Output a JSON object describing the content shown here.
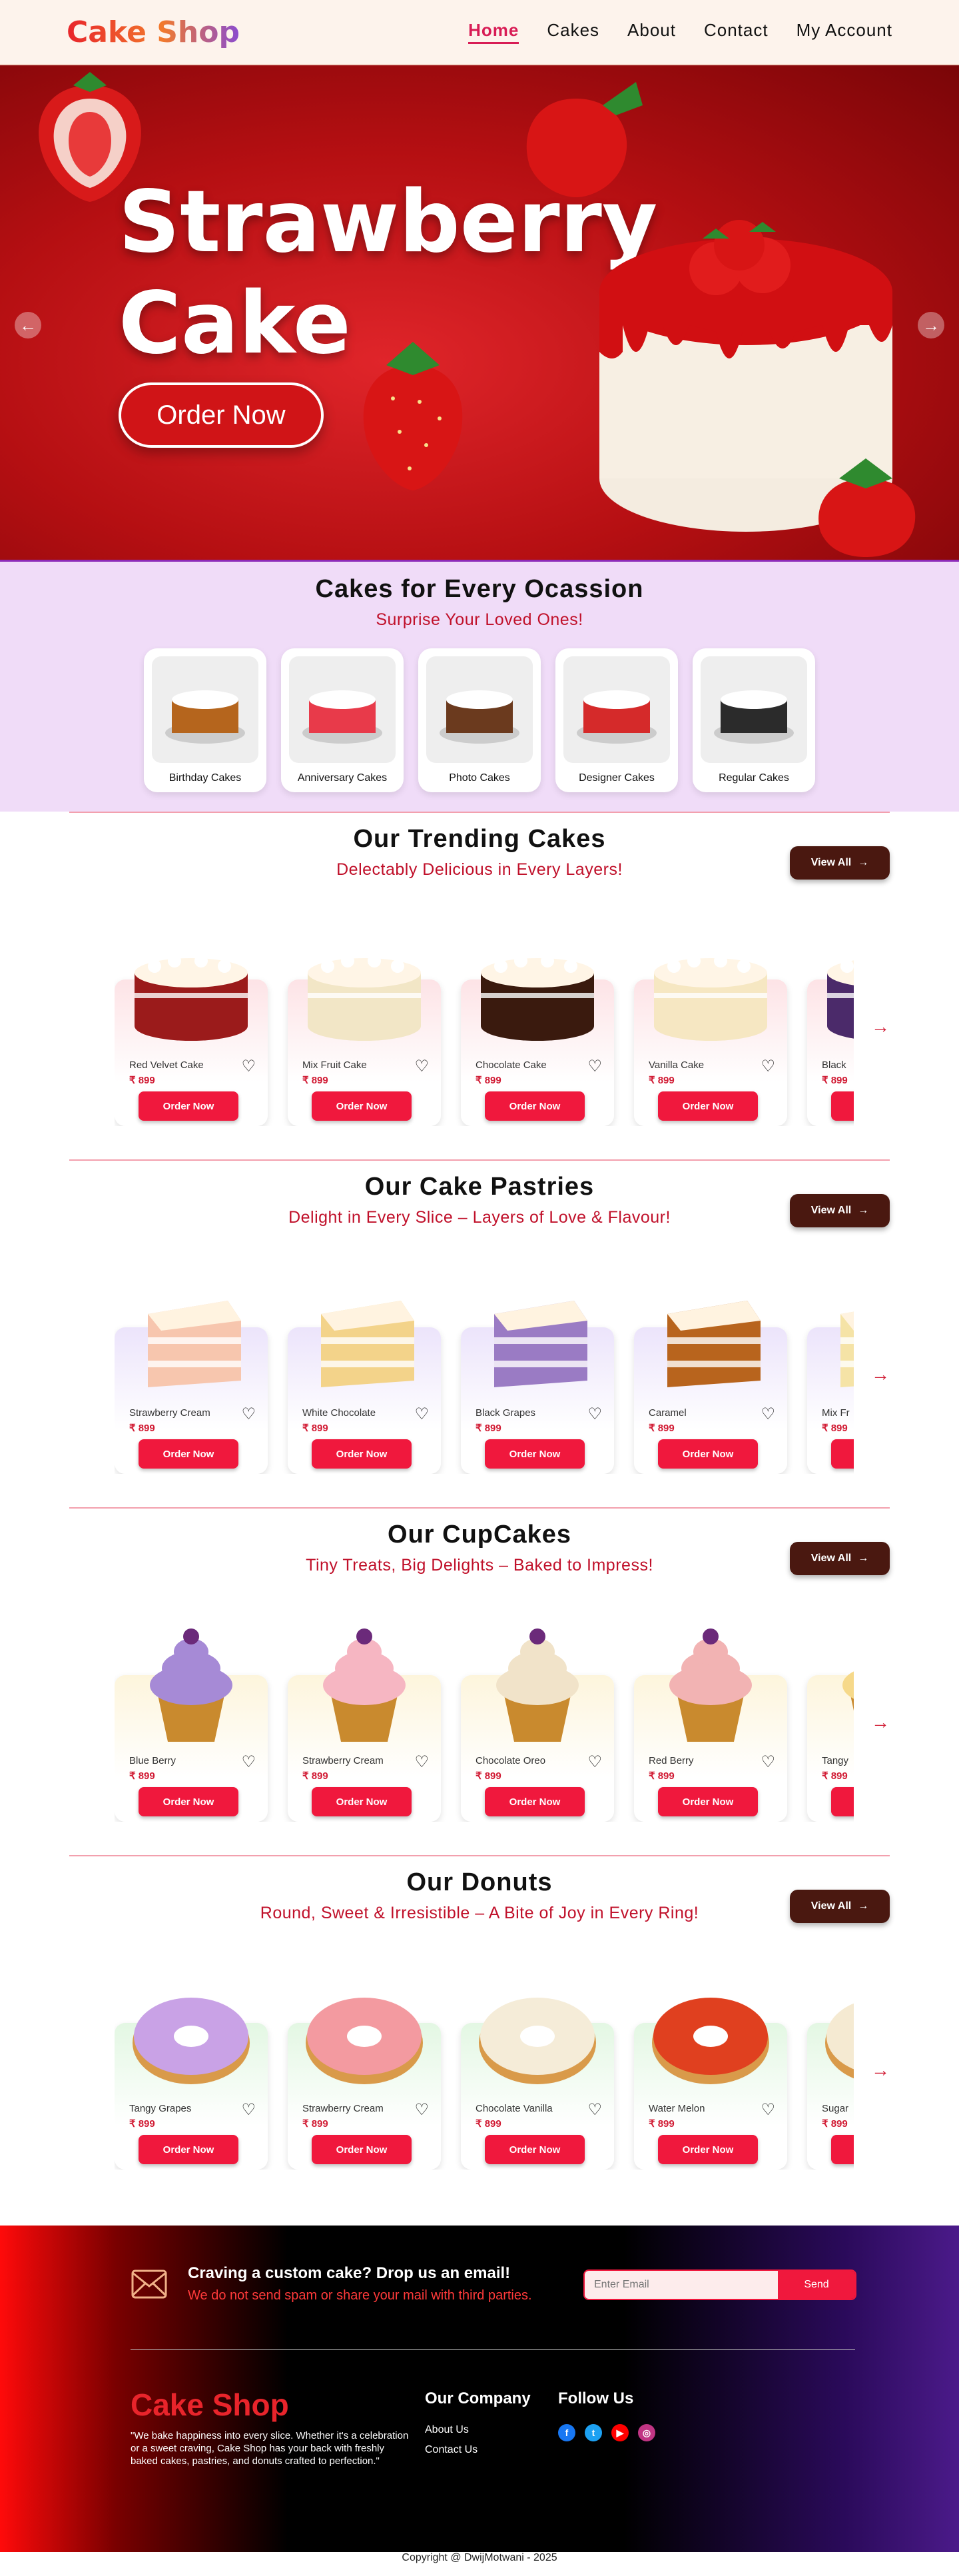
{
  "brand": "Cake Shop",
  "nav": [
    "Home",
    "Cakes",
    "About",
    "Contact",
    "My Account"
  ],
  "hero": {
    "title_line1": "Strawberry",
    "title_line2": "Cake",
    "cta": "Order Now"
  },
  "occasions": {
    "title": "Cakes for Every Ocassion",
    "subtitle": "Surprise Your Loved Ones!",
    "items": [
      {
        "label": "Birthday Cakes",
        "color": "#b5651d"
      },
      {
        "label": "Anniversary Cakes",
        "color": "#e83a4a"
      },
      {
        "label": "Photo Cakes",
        "color": "#6b3a1e"
      },
      {
        "label": "Designer Cakes",
        "color": "#d52a2a"
      },
      {
        "label": "Regular Cakes",
        "color": "#2b2b2b"
      }
    ]
  },
  "sections": [
    {
      "title": "Our Trending Cakes",
      "subtitle": "Delectably Delicious in Every Layers!",
      "view": "View All",
      "tint": "#fde3e6",
      "kind": "cake",
      "items": [
        {
          "name": "Red Velvet Cake",
          "price": "₹ 899",
          "color": "#9b1b1b"
        },
        {
          "name": "Mix Fruit Cake",
          "price": "₹ 899",
          "color": "#f2e6c6"
        },
        {
          "name": "Chocolate Cake",
          "price": "₹ 899",
          "color": "#3a1a0e"
        },
        {
          "name": "Vanilla Cake",
          "price": "₹ 899",
          "color": "#f6e7c2"
        },
        {
          "name": "Black",
          "price": "₹ 899",
          "color": "#4b2a6a"
        }
      ]
    },
    {
      "title": "Our Cake Pastries",
      "subtitle": "Delight in Every Slice – Layers of Love & Flavour!",
      "view": "View All",
      "tint": "#ece4fb",
      "kind": "slice",
      "items": [
        {
          "name": "Strawberry Cream",
          "price": "₹ 899",
          "color": "#f7c6ae"
        },
        {
          "name": "White Chocolate",
          "price": "₹ 899",
          "color": "#f3d38a"
        },
        {
          "name": "Black Grapes",
          "price": "₹ 899",
          "color": "#9a7bc4"
        },
        {
          "name": "Caramel",
          "price": "₹ 899",
          "color": "#b8641d"
        },
        {
          "name": "Mix Fr",
          "price": "₹ 899",
          "color": "#f5e3a6"
        }
      ]
    },
    {
      "title": "Our CupCakes",
      "subtitle": "Tiny Treats, Big Delights – Baked to Impress!",
      "view": "View All",
      "tint": "#fdf5dc",
      "kind": "cup",
      "items": [
        {
          "name": "Blue Berry",
          "price": "₹ 899",
          "color": "#a68ad6"
        },
        {
          "name": "Strawberry Cream",
          "price": "₹ 899",
          "color": "#f6b6c2"
        },
        {
          "name": "Chocolate Oreo",
          "price": "₹ 899",
          "color": "#f1e3c9"
        },
        {
          "name": "Red Berry",
          "price": "₹ 899",
          "color": "#f2b3b3"
        },
        {
          "name": "Tangy",
          "price": "₹ 899",
          "color": "#f6d98a"
        }
      ]
    },
    {
      "title": "Our Donuts",
      "subtitle": "Round, Sweet & Irresistible – A Bite of Joy in Every Ring!",
      "view": "View All",
      "tint": "#e3f7e3",
      "kind": "donut",
      "items": [
        {
          "name": "Tangy Grapes",
          "price": "₹ 899",
          "color": "#c9a2e6"
        },
        {
          "name": "Strawberry Cream",
          "price": "₹ 899",
          "color": "#f39aa0"
        },
        {
          "name": "Chocolate Vanilla",
          "price": "₹ 899",
          "color": "#f5ecd8"
        },
        {
          "name": "Water Melon",
          "price": "₹ 899",
          "color": "#e0401f"
        },
        {
          "name": "Sugar",
          "price": "₹ 899",
          "color": "#f5ead2"
        }
      ]
    }
  ],
  "card_button": "Order Now",
  "footer": {
    "mail_title": "Craving a custom cake? Drop us an email!",
    "mail_note": "We do not send spam or share your mail with third parties.",
    "email_placeholder": "Enter Email",
    "send": "Send",
    "brand": "Cake Shop",
    "desc": "\"We bake happiness into every slice. Whether it's a celebration or a sweet craving, Cake Shop has your back with freshly baked cakes, pastries, and donuts crafted to perfection.\"",
    "company_title": "Our Company",
    "links": [
      "About Us",
      "Contact Us"
    ],
    "follow_title": "Follow Us"
  },
  "copyright": "Copyright @  DwijMotwani - 2025"
}
